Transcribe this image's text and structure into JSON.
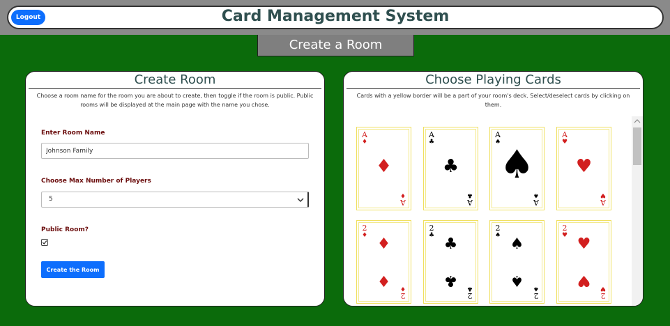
{
  "header": {
    "title": "Card Management System",
    "logout_label": "Logout"
  },
  "page_tab": "Create a Room",
  "create_room": {
    "title": "Create Room",
    "description": "Choose a room name for the room you are about to create, then toggle if the room is public. Public rooms will be displayed at the main page with the name you chose.",
    "room_name_label": "Enter Room Name",
    "room_name_value": "Johnson Family",
    "max_players_label": "Choose Max Number of Players",
    "max_players_value": "5",
    "public_label": "Public Room?",
    "public_checked": true,
    "submit_label": "Create the Room"
  },
  "choose_cards": {
    "title": "Choose Playing Cards",
    "description": "Cards with a yellow border will be a part of your room's deck. Select/deselect cards by clicking on them.",
    "cards": [
      {
        "rank": "A",
        "suit": "diamonds",
        "symbol": "♦",
        "color": "red"
      },
      {
        "rank": "A",
        "suit": "clubs",
        "symbol": "♣",
        "color": "black"
      },
      {
        "rank": "A",
        "suit": "spades",
        "symbol": "♠",
        "color": "black"
      },
      {
        "rank": "A",
        "suit": "hearts",
        "symbol": "♥",
        "color": "red"
      },
      {
        "rank": "2",
        "suit": "diamonds",
        "symbol": "♦",
        "color": "red"
      },
      {
        "rank": "2",
        "suit": "clubs",
        "symbol": "♣",
        "color": "black"
      },
      {
        "rank": "2",
        "suit": "spades",
        "symbol": "♠",
        "color": "black"
      },
      {
        "rank": "2",
        "suit": "hearts",
        "symbol": "♥",
        "color": "red"
      }
    ]
  },
  "colors": {
    "background": "#0b6b0b",
    "accent": "#0d6efd",
    "label": "#6b0d0d",
    "selected_border": "#f0e060"
  },
  "icons": {
    "select_arrow": "chevron-down-icon",
    "checkbox": "checkmark-icon",
    "scroll_up": "scroll-up-arrow-icon"
  }
}
